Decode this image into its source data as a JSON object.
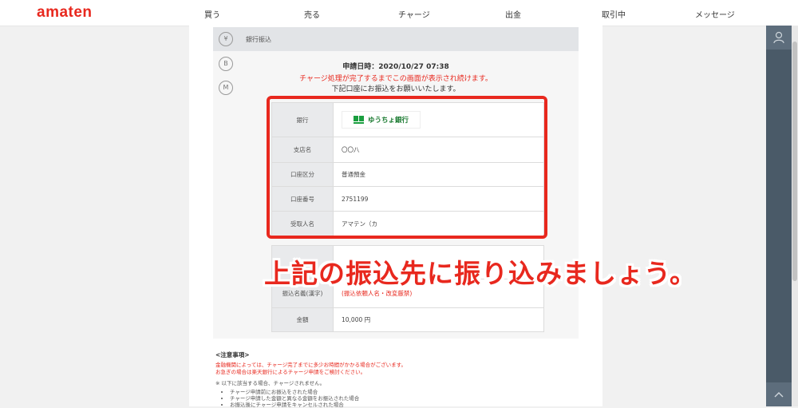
{
  "app": {
    "logo": "amaten"
  },
  "nav": {
    "items": [
      {
        "label": "買う"
      },
      {
        "label": "売る"
      },
      {
        "label": "チャージ"
      },
      {
        "label": "出金"
      },
      {
        "label": "取引中"
      },
      {
        "label": "メッセージ"
      }
    ]
  },
  "sidebar": {
    "icons": [
      {
        "name": "yen-icon",
        "glyph": "¥"
      },
      {
        "name": "bitcoin-icon",
        "glyph": "B"
      },
      {
        "name": "amazon-icon",
        "glyph": "M"
      }
    ]
  },
  "section": {
    "title": "銀行振込"
  },
  "request": {
    "date": "申請日時：2020/10/27 07:38",
    "notice_red": "チャージ処理が完了するまでこの画面が表示され続けます。",
    "notice": "下記口座にお振込をお願いいたします。"
  },
  "bank_table": {
    "rows": [
      {
        "label": "銀行",
        "value": "ゆうちょ銀行"
      },
      {
        "label": "支店名",
        "value": "〇〇八"
      },
      {
        "label": "口座区分",
        "value": "普通預金"
      },
      {
        "label": "口座番号",
        "value": "2751199"
      },
      {
        "label": "受取人名",
        "value": "アマテン（カ"
      }
    ]
  },
  "transfer_table": {
    "rows": [
      {
        "label": "振込名義(漢字)",
        "value": "(振込依頼人名・改変厳禁)"
      },
      {
        "label": "金額",
        "value": "10,000 円"
      }
    ]
  },
  "overlay": {
    "caption": "上記の振込先に振り込みましょう。"
  },
  "notes": {
    "title": "<注意事項>",
    "red_line1": "金融機関によっては、チャージ完了までに多少お時間がかかる場合がございます。",
    "red_line2": "お急ぎの場合は楽天銀行によるチャージ申請をご検討ください。",
    "plain": "※ 以下に該当する場合、チャージされません。",
    "items": [
      "チャージ申請前にお振込をされた場合",
      "チャージ申請した金額と異なる金額をお振込された場合",
      "お振込後にチャージ申請をキャンセルされた場合"
    ]
  },
  "colors": {
    "accent": "#e8281e",
    "panel": "#4a5a68"
  }
}
